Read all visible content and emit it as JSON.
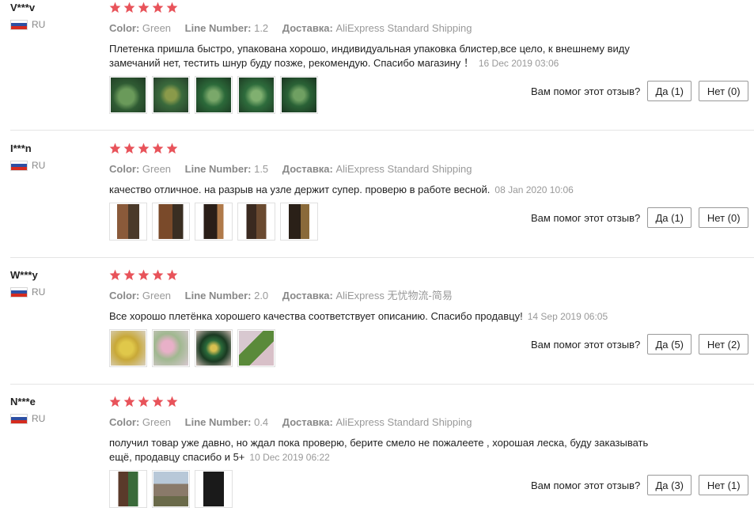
{
  "labels": {
    "color": "Color:",
    "line_number": "Line Number:",
    "shipping": "Доставка:",
    "helpful_question": "Вам помог этот отзыв?"
  },
  "star_color": "#e8535a",
  "reviews": [
    {
      "user": "V***v",
      "country": "RU",
      "rating": 5,
      "color": "Green",
      "line_number": "1.2",
      "shipping": "AliExpress Standard Shipping",
      "text": "Плетенка пришла быстро, упакована хорошо, индивидуальная упаковка блистер,все цело, к внешнему виду замечаний нет, тестить шнур буду позже, рекомендую. Спасибо магазину ！",
      "date": "16 Dec 2019 03:06",
      "photo_count": 5,
      "yes": "Да (1)",
      "no": "Нет (0)"
    },
    {
      "user": "I***n",
      "country": "RU",
      "rating": 5,
      "color": "Green",
      "line_number": "1.5",
      "shipping": "AliExpress Standard Shipping",
      "text": "качество отличное. на разрыв на узле держит супер. проверю в работе весной.",
      "date": "08 Jan 2020 10:06",
      "photo_count": 5,
      "yes": "Да (1)",
      "no": "Нет (0)"
    },
    {
      "user": "W***y",
      "country": "RU",
      "rating": 5,
      "color": "Green",
      "line_number": "2.0",
      "shipping": "AliExpress 无忧物流-简易",
      "text": "Все хорошо плетёнка хорошего качества соответствует описанию. Спасибо продавцу!",
      "date": "14 Sep 2019 06:05",
      "photo_count": 4,
      "yes": "Да (5)",
      "no": "Нет (2)"
    },
    {
      "user": "N***e",
      "country": "RU",
      "rating": 5,
      "color": "Green",
      "line_number": "0.4",
      "shipping": "AliExpress Standard Shipping",
      "text": "получил товар уже давно, но ждал пока проверю, берите смело не пожалеете , хорошая леска, буду заказывать ещё, продавцу спасибо и 5+",
      "date": "10 Dec 2019 06:22",
      "photo_count": 3,
      "yes": "Да (3)",
      "no": "Нет (1)"
    }
  ]
}
